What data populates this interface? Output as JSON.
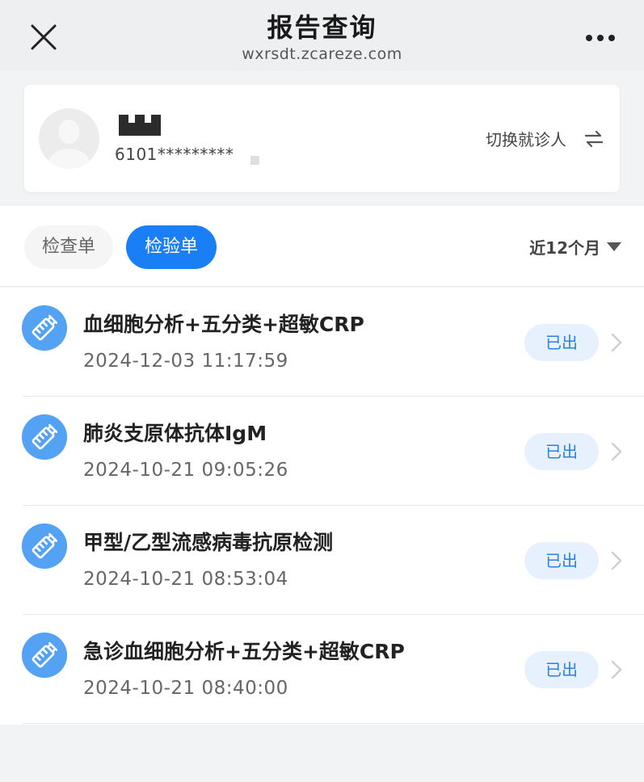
{
  "header": {
    "title": "报告查询",
    "url": "wxrsdt.zcareze.com"
  },
  "patient": {
    "id": "6101*********",
    "switch_label": "切换就诊人"
  },
  "tabs": [
    {
      "label": "检查单",
      "active": false
    },
    {
      "label": "检验单",
      "active": true
    }
  ],
  "filter": {
    "period": "近12个月"
  },
  "reports": [
    {
      "title": "血细胞分析+五分类+超敏CRP",
      "time": "2024-12-03 11:17:59",
      "status": "已出"
    },
    {
      "title": "肺炎支原体抗体IgM",
      "time": "2024-10-21 09:05:26",
      "status": "已出"
    },
    {
      "title": "甲型/乙型流感病毒抗原检测",
      "time": "2024-10-21 08:53:04",
      "status": "已出"
    },
    {
      "title": "急诊血细胞分析+五分类+超敏CRP",
      "time": "2024-10-21 08:40:00",
      "status": "已出"
    }
  ],
  "colors": {
    "accent": "#1a7ef5",
    "icon_bg": "#53a2f4",
    "badge_bg": "#e6f1fd",
    "badge_text": "#2a7fe0"
  },
  "icons": {
    "close": "close-icon",
    "more": "more-icon",
    "switch": "swap-arrows-icon",
    "report": "test-tube-icon",
    "chevron": "chevron-right-icon"
  }
}
